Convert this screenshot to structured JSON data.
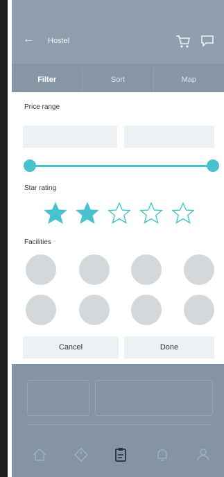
{
  "header": {
    "back_icon": "back-arrow-icon",
    "title": "Hostel",
    "cart_icon": "cart-icon",
    "chat_icon": "chat-icon"
  },
  "tabs": [
    {
      "label": "Filter",
      "active": true
    },
    {
      "label": "Sort",
      "active": false
    },
    {
      "label": "Map",
      "active": false
    }
  ],
  "filter": {
    "price_range_label": "Price range",
    "price_min_value": "",
    "price_max_value": "",
    "slider_range": [
      0,
      1
    ],
    "star_rating_label": "Star rating",
    "rating": {
      "value": 2,
      "max": 5
    },
    "facilities_label": "Facilities",
    "facility_count": 8,
    "cancel_label": "Cancel",
    "done_label": "Done"
  },
  "colors": {
    "accent": "#48c2cc",
    "overlay": "#8494a3",
    "surface": "#ffffff",
    "field": "#eef1f4",
    "placeholder": "#d4d8db"
  },
  "bottom_nav": [
    {
      "icon": "home-icon"
    },
    {
      "icon": "tag-icon"
    },
    {
      "icon": "clipboard-icon",
      "active": true
    },
    {
      "icon": "bell-icon"
    },
    {
      "icon": "profile-icon"
    }
  ]
}
